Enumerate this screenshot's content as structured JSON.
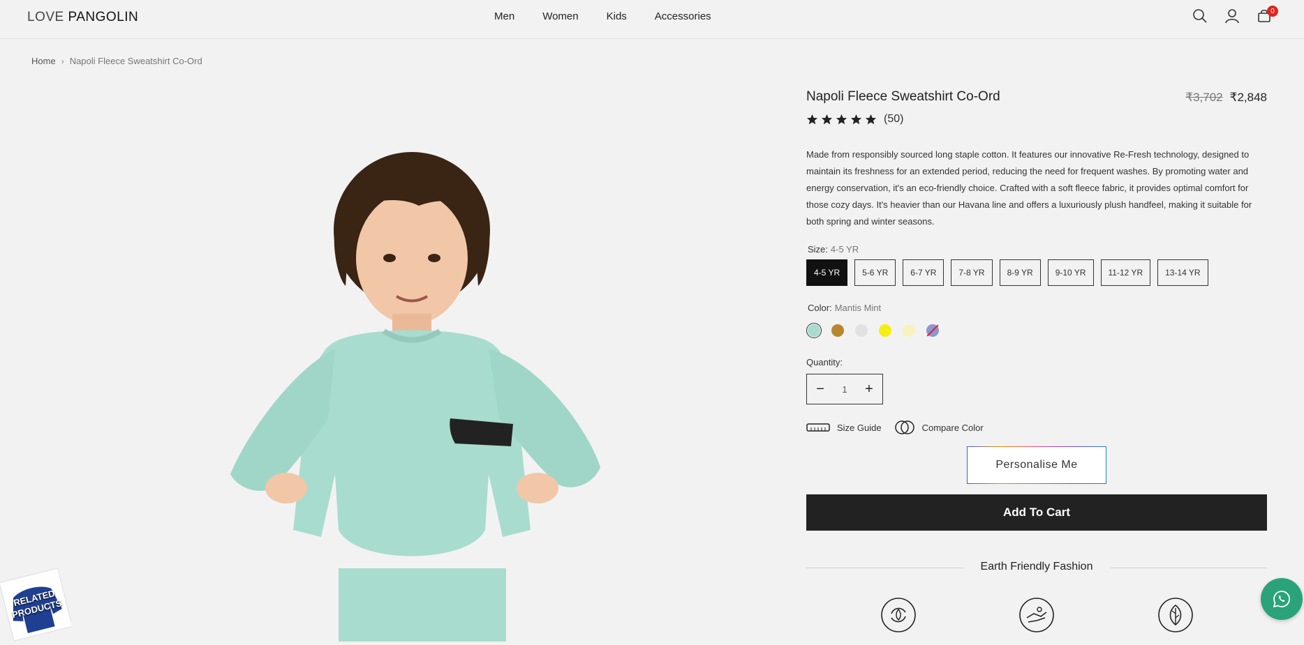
{
  "header": {
    "logo_part1": "LOVE",
    "logo_part2": "PANGOLIN",
    "nav": [
      "Men",
      "Women",
      "Kids",
      "Accessories"
    ],
    "cart_count": "0",
    "icons": [
      "search-icon",
      "user-icon",
      "cart-icon"
    ]
  },
  "breadcrumb": {
    "home": "Home",
    "separator": "›",
    "current": "Napoli Fleece Sweatshirt Co-Ord"
  },
  "related": {
    "label_line1": "RELATED",
    "label_line2": "PRODUCTS"
  },
  "product": {
    "title": "Napoli Fleece Sweatshirt Co-Ord",
    "old_price": "₹3,702",
    "price": "₹2,848",
    "rating": 5,
    "review_count": "(50)",
    "description": "Made from responsibly sourced long staple cotton. It features our innovative Re-Fresh technology, designed to maintain its freshness for an extended period, reducing the need for frequent washes. By promoting water and energy conservation, it's an eco-friendly choice. Crafted with a soft fleece fabric, it provides optimal comfort for those cozy days. It's heavier than our Havana line and offers a luxuriously plush handfeel, making it suitable for both spring and winter seasons.",
    "size_label": "Size:",
    "selected_size": "4-5 YR",
    "sizes": [
      "4-5 YR",
      "5-6 YR",
      "6-7 YR",
      "7-8 YR",
      "8-9 YR",
      "9-10 YR",
      "11-12 YR",
      "13-14 YR"
    ],
    "color_label": "Color:",
    "selected_color": "Mantis Mint",
    "colors": [
      {
        "hex": "#a8dccf",
        "available": true
      },
      {
        "hex": "#b8862c",
        "available": true
      },
      {
        "hex": "#e2e2e2",
        "available": true
      },
      {
        "hex": "#f4ef11",
        "available": true
      },
      {
        "hex": "#f7f2bf",
        "available": true
      },
      {
        "hex": "#8b96d6",
        "available": false
      }
    ],
    "quantity_label": "Quantity:",
    "quantity": "1",
    "size_guide": "Size Guide",
    "compare_color": "Compare Color",
    "personalise": "Personalise Me",
    "add_to_cart": "Add To Cart",
    "earth_friendly": "Earth Friendly Fashion"
  },
  "colors": {
    "accent_dark": "#222222",
    "badge": "#e1251b",
    "whatsapp": "#2aa37a",
    "background": "#f2f2f2"
  }
}
